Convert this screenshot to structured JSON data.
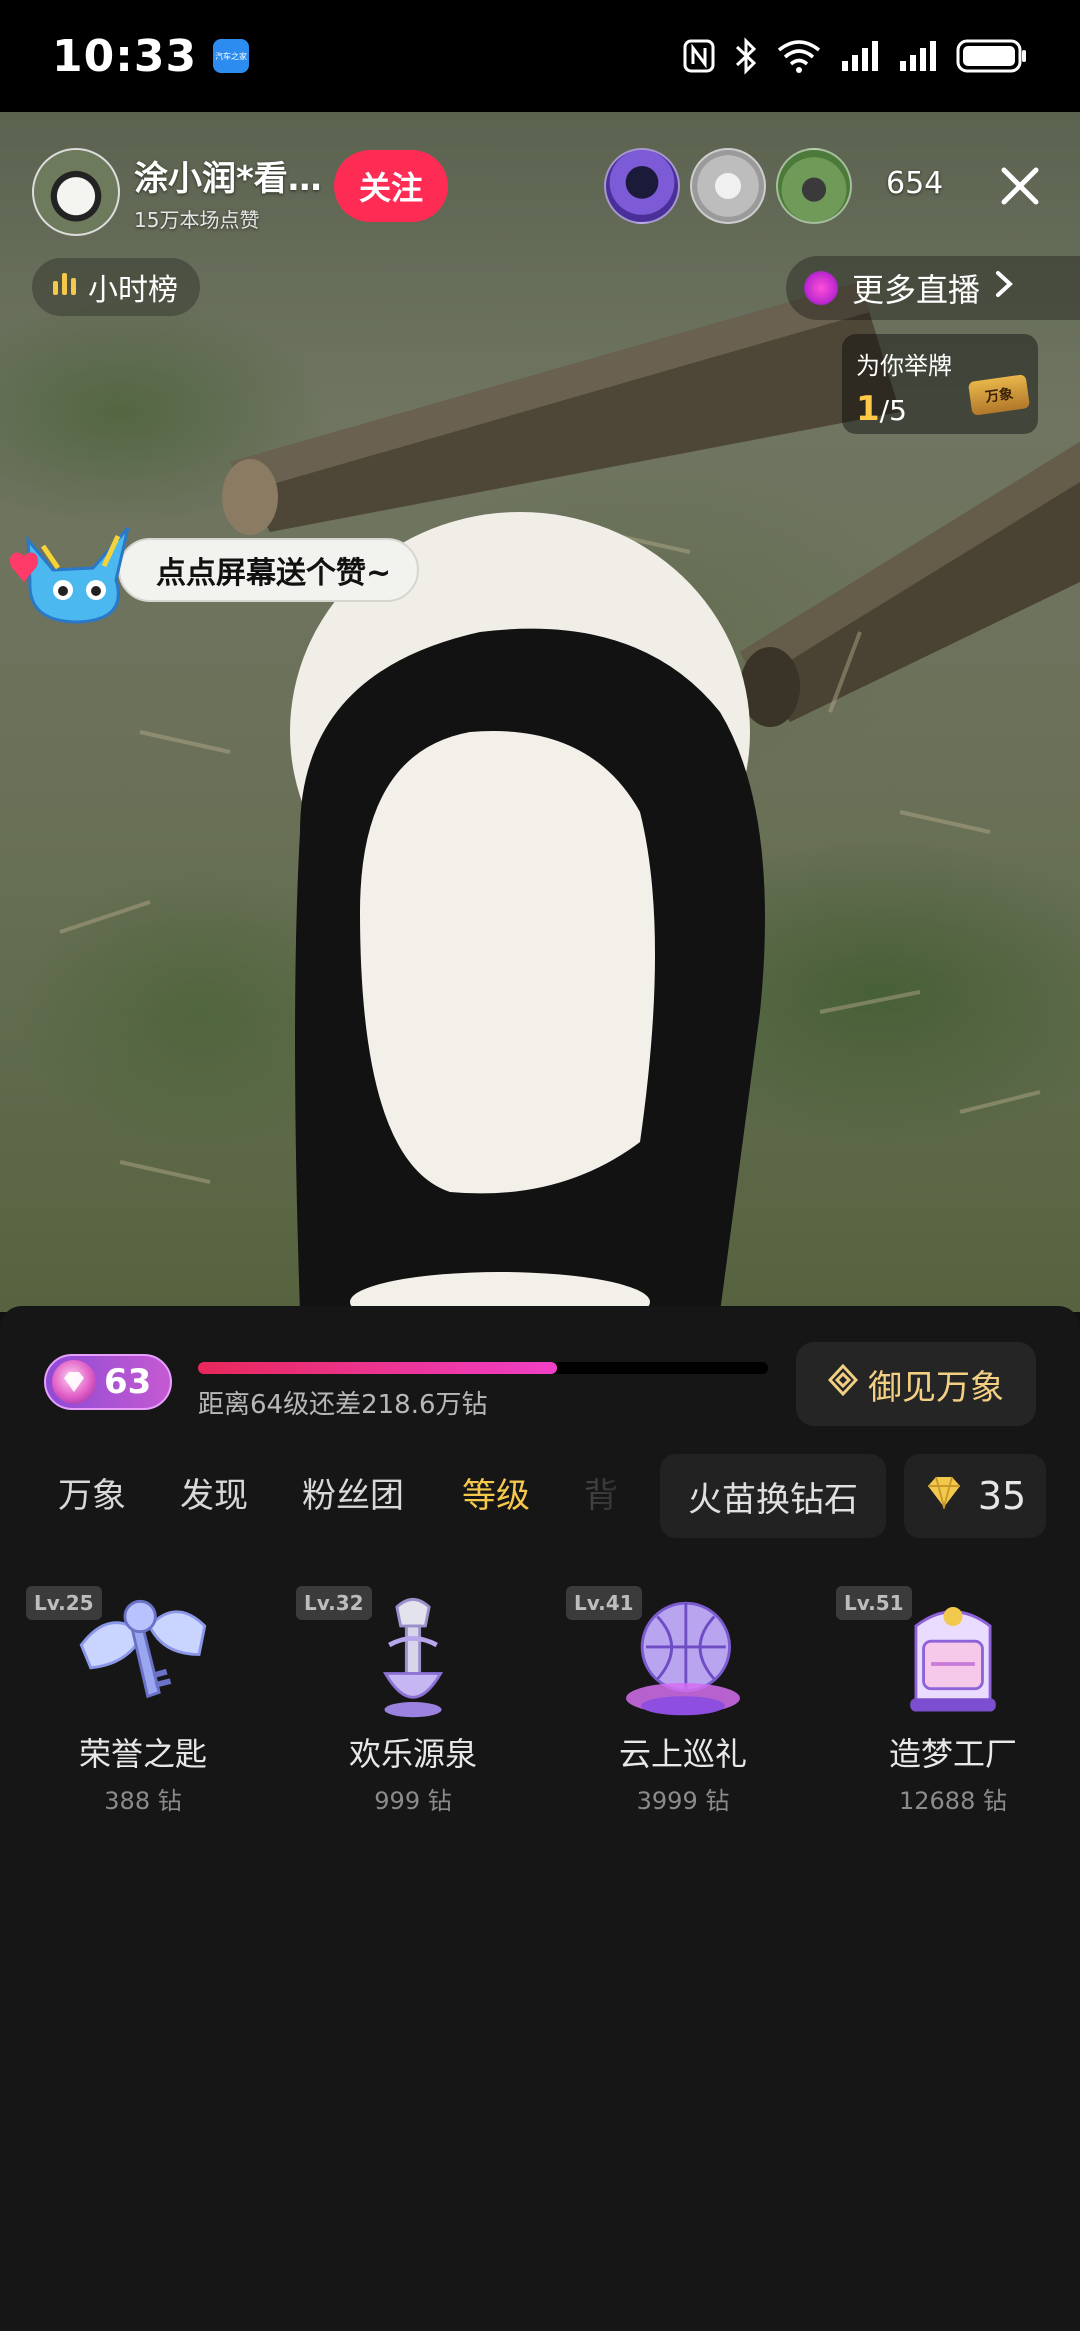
{
  "status_bar": {
    "time": "10:33",
    "app_badge": "汽车之家",
    "icons": [
      "nfc-icon",
      "bluetooth-icon",
      "wifi-icon",
      "signal-icon",
      "signal-icon",
      "battery-icon"
    ]
  },
  "live": {
    "anchor_name": "涂小润*看…",
    "likes_text": "15万本场点赞",
    "follow_label": "关注",
    "viewer_count": "654",
    "hour_rank_label": "小时榜",
    "more_live_label": "更多直播",
    "ad": {
      "title": "为你举牌",
      "current": "1",
      "total": "/5",
      "logo_text": "万象"
    },
    "like_tip": "点点屏幕送个赞~"
  },
  "level_panel": {
    "level": "63",
    "progress": 0.63,
    "progress_text": "距离64级还差218.6万钻",
    "vision_button": "御见万象"
  },
  "tabs": [
    {
      "label": "万象"
    },
    {
      "label": "发现"
    },
    {
      "label": "粉丝团"
    },
    {
      "label": "等级"
    },
    {
      "label": "背"
    }
  ],
  "active_tab": "等级",
  "exchange_button": "火苗换钻石",
  "diamond_balance": "35",
  "gifts": [
    {
      "level": "Lv.25",
      "name": "荣誉之匙",
      "price": "388 钻"
    },
    {
      "level": "Lv.32",
      "name": "欢乐源泉",
      "price": "999 钻"
    },
    {
      "level": "Lv.41",
      "name": "云上巡礼",
      "price": "3999 钻"
    },
    {
      "level": "Lv.51",
      "name": "造梦工厂",
      "price": "12688 钻"
    }
  ],
  "colors": {
    "accent_pink": "#fe2c55",
    "gold": "#f5c84b",
    "sheet_bg": "#161616"
  }
}
